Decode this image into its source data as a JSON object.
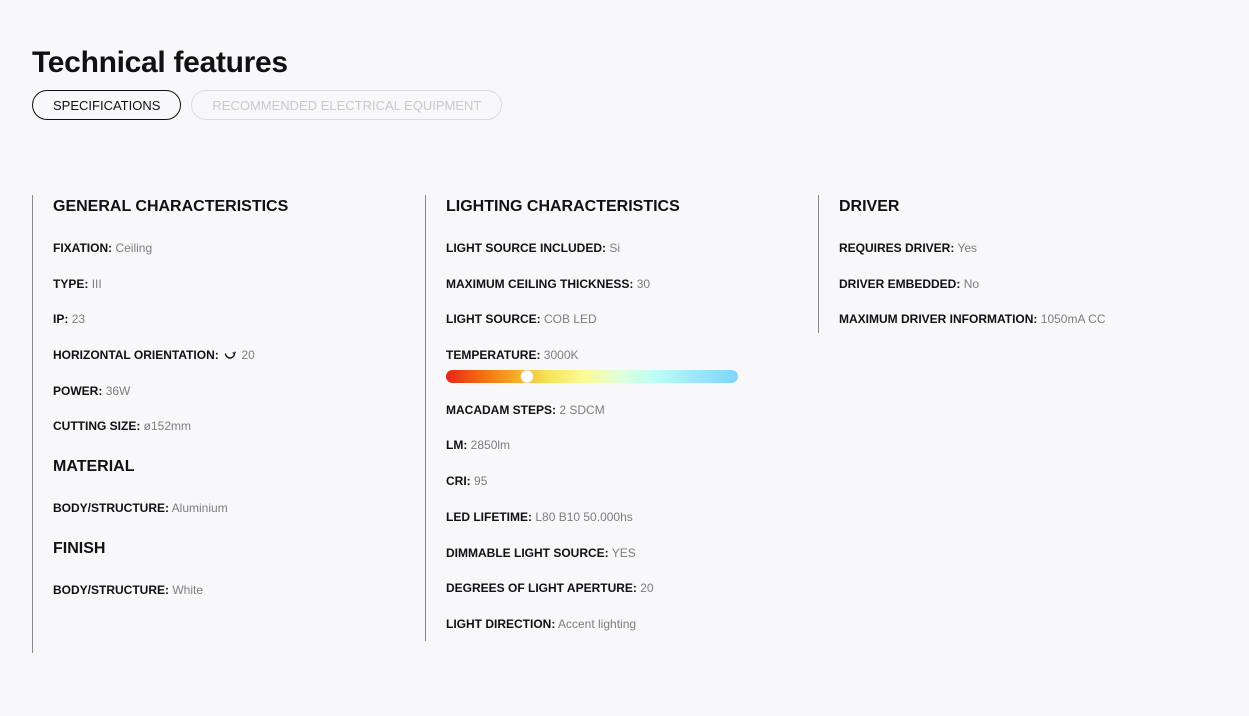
{
  "page": {
    "title": "Technical features",
    "tabs": [
      {
        "label": "SPECIFICATIONS",
        "active": true
      },
      {
        "label": "RECOMMENDED ELECTRICAL EQUIPMENT",
        "active": false
      }
    ]
  },
  "general": {
    "title": "GENERAL CHARACTERISTICS",
    "rows": [
      {
        "k": "FIXATION:",
        "v": "Ceiling"
      },
      {
        "k": "TYPE:",
        "v": "III"
      },
      {
        "k": "IP:",
        "v": "23"
      },
      {
        "k": "HORIZONTAL ORIENTATION:",
        "v": "20",
        "icon": "rotate-icon"
      },
      {
        "k": "POWER:",
        "v": "36W"
      },
      {
        "k": "CUTTING SIZE:",
        "v": "ø152mm"
      }
    ]
  },
  "material": {
    "title": "MATERIAL",
    "rows": [
      {
        "k": "BODY/STRUCTURE:",
        "v": "Aluminium"
      }
    ]
  },
  "finish": {
    "title": "FINISH",
    "rows": [
      {
        "k": "BODY/STRUCTURE:",
        "v": "White"
      }
    ]
  },
  "lighting": {
    "title": "LIGHTING CHARACTERISTICS",
    "rows": [
      {
        "k": "LIGHT SOURCE INCLUDED:",
        "v": "Si"
      },
      {
        "k": "MAXIMUM CEILING THICKNESS:",
        "v": "30"
      },
      {
        "k": "LIGHT SOURCE:",
        "v": "COB LED"
      },
      {
        "k": "TEMPERATURE:",
        "v": "3000K"
      },
      {
        "k": "MACADAM STEPS:",
        "v": "2 SDCM"
      },
      {
        "k": "LM:",
        "v": "2850lm"
      },
      {
        "k": "CRI:",
        "v": "95"
      },
      {
        "k": "LED LIFETIME:",
        "v": "L80 B10 50.000hs"
      },
      {
        "k": "DIMMABLE LIGHT SOURCE:",
        "v": "YES"
      },
      {
        "k": "DEGREES OF LIGHT APERTURE:",
        "v": "20"
      },
      {
        "k": "LIGHT DIRECTION:",
        "v": "Accent lighting"
      }
    ],
    "temperature_scale": {
      "min": 1800,
      "max": 6500,
      "value": 3000
    }
  },
  "driver": {
    "title": "DRIVER",
    "rows": [
      {
        "k": "REQUIRES DRIVER:",
        "v": "Yes"
      },
      {
        "k": "DRIVER EMBEDDED:",
        "v": "No"
      },
      {
        "k": "MAXIMUM DRIVER INFORMATION:",
        "v": "1050mA CC"
      }
    ]
  },
  "colors": {
    "background": "#f8f8fa",
    "text": "#111111",
    "muted": "#7c7c82",
    "divider": "#8a8a8e"
  }
}
